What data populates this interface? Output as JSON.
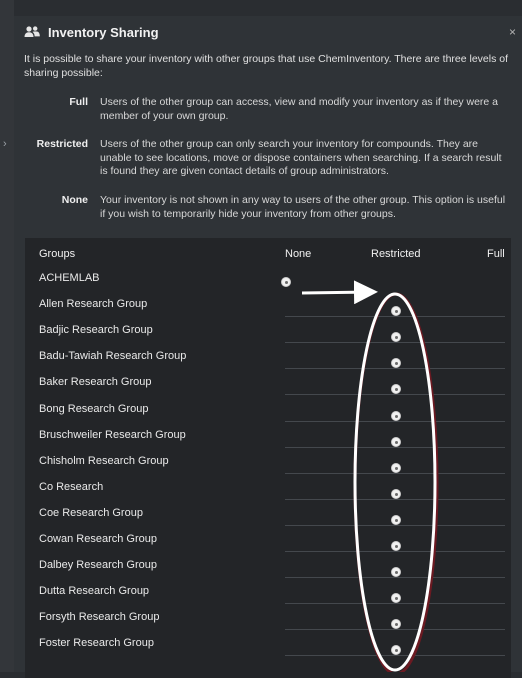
{
  "dialog": {
    "title": "Inventory Sharing",
    "close": "×",
    "intro": "It is possible to share your inventory with other groups that use ChemInventory. There are three levels of sharing possible:"
  },
  "levels": [
    {
      "name": "Full",
      "description": "Users of the other group can access, view and modify your inventory as if they were a member of your own group."
    },
    {
      "name": "Restricted",
      "description": "Users of the other group can only search your inventory for compounds. They are unable to see locations, move or dispose containers when searching. If a search result is found they are given contact details of group administrators."
    },
    {
      "name": "None",
      "description": "Your inventory is not shown in any way to users of the other group. This option is useful if you wish to temporarily hide your inventory from other groups."
    }
  ],
  "table": {
    "headers": {
      "groups": "Groups",
      "none": "None",
      "restricted": "Restricted",
      "full": "Full"
    },
    "rows": [
      {
        "name": "ACHEMLAB",
        "selected": "none"
      },
      {
        "name": "Allen Research Group",
        "selected": "restricted"
      },
      {
        "name": "Badjic Research Group",
        "selected": "restricted"
      },
      {
        "name": "Badu-Tawiah Research Group",
        "selected": "restricted"
      },
      {
        "name": "Baker Research Group",
        "selected": "restricted"
      },
      {
        "name": "Bong Research Group",
        "selected": "restricted"
      },
      {
        "name": "Bruschweiler Research Group",
        "selected": "restricted"
      },
      {
        "name": "Chisholm Research Group",
        "selected": "restricted"
      },
      {
        "name": "Co Research",
        "selected": "restricted"
      },
      {
        "name": "Coe Research Group",
        "selected": "restricted"
      },
      {
        "name": "Cowan Research Group",
        "selected": "restricted"
      },
      {
        "name": "Dalbey Research Group",
        "selected": "restricted"
      },
      {
        "name": "Dutta Research Group",
        "selected": "restricted"
      },
      {
        "name": "Forsyth Research Group",
        "selected": "restricted"
      },
      {
        "name": "Foster Research Group",
        "selected": "restricted"
      }
    ]
  },
  "icons": {
    "title": "users-icon",
    "close": "close-icon",
    "annotation": "arrow-and-ellipse"
  },
  "colors": {
    "background": "#2a2d31",
    "modal": "#2f3337",
    "panel": "#232528",
    "text": "#e8e8e8",
    "annotation": "#ffffff",
    "ellipse_shadow": "#6b1a22"
  }
}
